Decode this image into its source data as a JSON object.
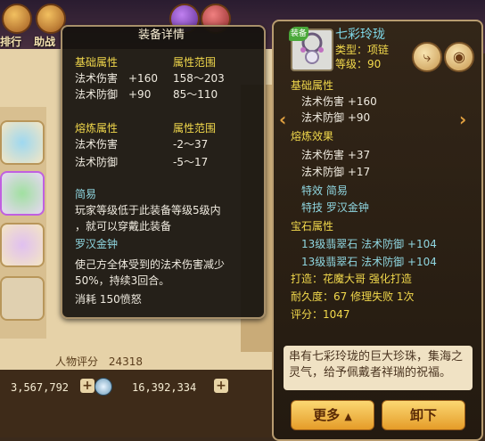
{
  "background": {
    "top_labels": [
      "排行",
      "助战"
    ],
    "player_score_label": "人物评分",
    "player_score": "24318",
    "currency1": "3,567,792",
    "currency2": "16,392,334",
    "plus": "+"
  },
  "tooltip": {
    "title": "装备详情",
    "base_header": "基础属性",
    "base_range_header": "属性范围",
    "base_attrs": [
      {
        "name": "法术伤害",
        "value": "+160",
        "range": "158～203"
      },
      {
        "name": "法术防御",
        "value": "+90",
        "range": "85～110"
      }
    ],
    "refine_header": "熔炼属性",
    "refine_range_header": "属性范围",
    "refine_attrs": [
      {
        "name": "法术伤害",
        "range": "-2～37"
      },
      {
        "name": "法术防御",
        "range": "-5～17"
      }
    ],
    "special1_name": "简易",
    "special1_desc_line1": "玩家等级低于此装备等级5级内",
    "special1_desc_line2": "，就可以穿戴此装备",
    "special2_name": "罗汉金钟",
    "special2_desc_line1": "使己方全体受到的法术伤害减少",
    "special2_desc_line2": "50%，持续3回合。",
    "special2_cost": "消耗 150愤怒"
  },
  "item": {
    "name": "七彩玲珑",
    "equipped_badge": "装备",
    "type": "类型：项链",
    "level": "等级：90",
    "base_header": "基础属性",
    "base_attrs": [
      "法术伤害 +160",
      "法术防御 +90"
    ],
    "refine_header": "熔炼效果",
    "refine_attrs": [
      "法术伤害 +37",
      "法术防御 +17"
    ],
    "special_effect": "特效  简易",
    "special_skill": "特技  罗汉金钟",
    "gem_header": "宝石属性",
    "gems": [
      "13级翡翠石  法术防御 +104",
      "13级翡翠石  法术防御 +104"
    ],
    "maker": "打造：花魔大哥  强化打造",
    "durability": "耐久度：67 修理失败 1次",
    "score": "评分：1047",
    "description": "串有七彩玲珑的巨大珍珠，集海之灵气，给予佩戴者祥瑞的祝福。",
    "more_button": "更多",
    "unequip_button": "卸下"
  },
  "colors": {
    "attr_yellow": "#f2d94c",
    "attr_white": "#f0ebe0",
    "attr_cyan": "#8fd6e0",
    "button_gold": "#fbd873"
  }
}
